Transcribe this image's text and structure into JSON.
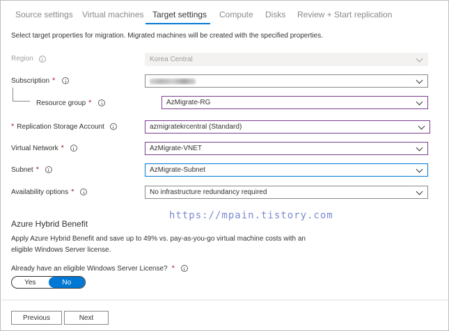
{
  "tabs": [
    {
      "label": "Source settings",
      "active": false
    },
    {
      "label": "Virtual machines",
      "active": false
    },
    {
      "label": "Target settings",
      "active": true
    },
    {
      "label": "Compute",
      "active": false
    },
    {
      "label": "Disks",
      "active": false
    },
    {
      "label": "Review + Start replication",
      "active": false
    }
  ],
  "intro": "Select target properties for migration. Migrated machines will be created with the specified properties.",
  "fields": {
    "region": {
      "label": "Region",
      "value": "Korea Central"
    },
    "subscription": {
      "label": "Subscription",
      "value": ""
    },
    "resource_group": {
      "label": "Resource group",
      "value": "AzMigrate-RG"
    },
    "replication_storage": {
      "label": "Replication Storage Account",
      "value": "azmigratekrcentral (Standard)"
    },
    "virtual_network": {
      "label": "Virtual Network",
      "value": "AzMigrate-VNET"
    },
    "subnet": {
      "label": "Subnet",
      "value": "AzMigrate-Subnet"
    },
    "availability": {
      "label": "Availability options",
      "value": "No infrastructure redundancy required"
    }
  },
  "watermark": "https://mpain.tistory.com",
  "hybrid": {
    "title": "Azure Hybrid Benefit",
    "description": "Apply Azure Hybrid Benefit and save up to 49% vs. pay-as-you-go virtual machine costs with an eligible Windows Server license.",
    "question": "Already have an eligible Windows Server License?",
    "yes": "Yes",
    "no": "No",
    "selected": "No"
  },
  "buttons": {
    "previous": "Previous",
    "next": "Next"
  },
  "required_mark": "*",
  "colors": {
    "accent": "#0078d4",
    "required": "#a4262c",
    "highlight_border": "#7a3d8f"
  }
}
